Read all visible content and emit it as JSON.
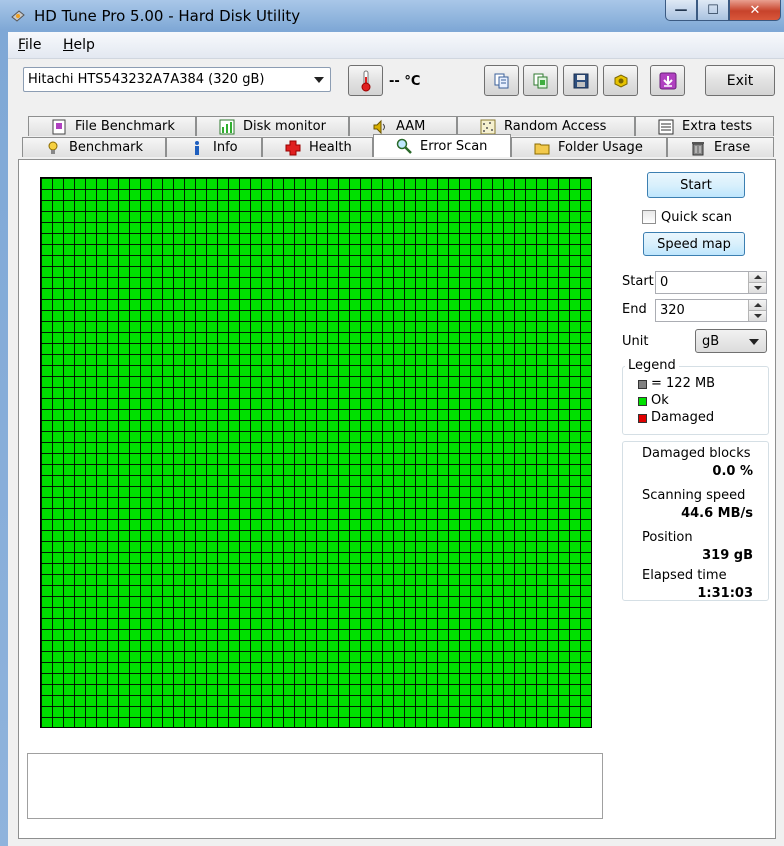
{
  "window": {
    "title": "HD Tune Pro 5.00 - Hard Disk Utility",
    "controls": {
      "minimize": "—",
      "maximize": "☐",
      "close": "✕"
    }
  },
  "menu": {
    "items": [
      {
        "label_pre": "",
        "label_key": "F",
        "label_post": "ile"
      },
      {
        "label_pre": "",
        "label_key": "H",
        "label_post": "elp"
      }
    ]
  },
  "toolbar": {
    "drive": "Hitachi HTS543232A7A384  (320 gB)",
    "temperature": "-- °C",
    "exit_label": "Exit",
    "icons": [
      "copy-info-icon",
      "copy-screenshot-icon",
      "save-icon",
      "options-icon",
      "download-icon"
    ]
  },
  "tabs": {
    "row1": [
      {
        "label": "File Benchmark",
        "icon": "file-benchmark-icon"
      },
      {
        "label": "Disk monitor",
        "icon": "disk-monitor-icon"
      },
      {
        "label": "AAM",
        "icon": "speaker-icon"
      },
      {
        "label": "Random Access",
        "icon": "random-access-icon"
      },
      {
        "label": "Extra tests",
        "icon": "extra-tests-icon"
      }
    ],
    "row2": [
      {
        "label": "Benchmark",
        "icon": "benchmark-icon"
      },
      {
        "label": "Info",
        "icon": "info-icon"
      },
      {
        "label": "Health",
        "icon": "health-cross-icon"
      },
      {
        "label": "Error Scan",
        "icon": "magnifier-icon",
        "active": true
      },
      {
        "label": "Folder Usage",
        "icon": "folder-icon"
      },
      {
        "label": "Erase",
        "icon": "trash-icon"
      }
    ]
  },
  "scan_map": {
    "columns": 50,
    "rows": 50,
    "block_status": "ok",
    "colors": {
      "ok": "#00e000",
      "damaged": "#e00000",
      "unscanned": "#808080"
    }
  },
  "controls": {
    "start_label": "Start",
    "quick_scan_label": "Quick scan",
    "quick_scan_checked": false,
    "speed_map_label": "Speed map",
    "start_field_label": "Start",
    "start_value": "0",
    "end_field_label": "End",
    "end_value": "320",
    "unit_label": "Unit",
    "unit_value": "gB"
  },
  "legend": {
    "title": "Legend",
    "block_size": "= 122 MB",
    "ok": "Ok",
    "damaged": "Damaged"
  },
  "stats": {
    "damaged_blocks_label": "Damaged blocks",
    "damaged_blocks_value": "0.0 %",
    "scanning_speed_label": "Scanning speed",
    "scanning_speed_value": "44.6 MB/s",
    "position_label": "Position",
    "position_value": "319 gB",
    "elapsed_label": "Elapsed time",
    "elapsed_value": "1:31:03"
  }
}
